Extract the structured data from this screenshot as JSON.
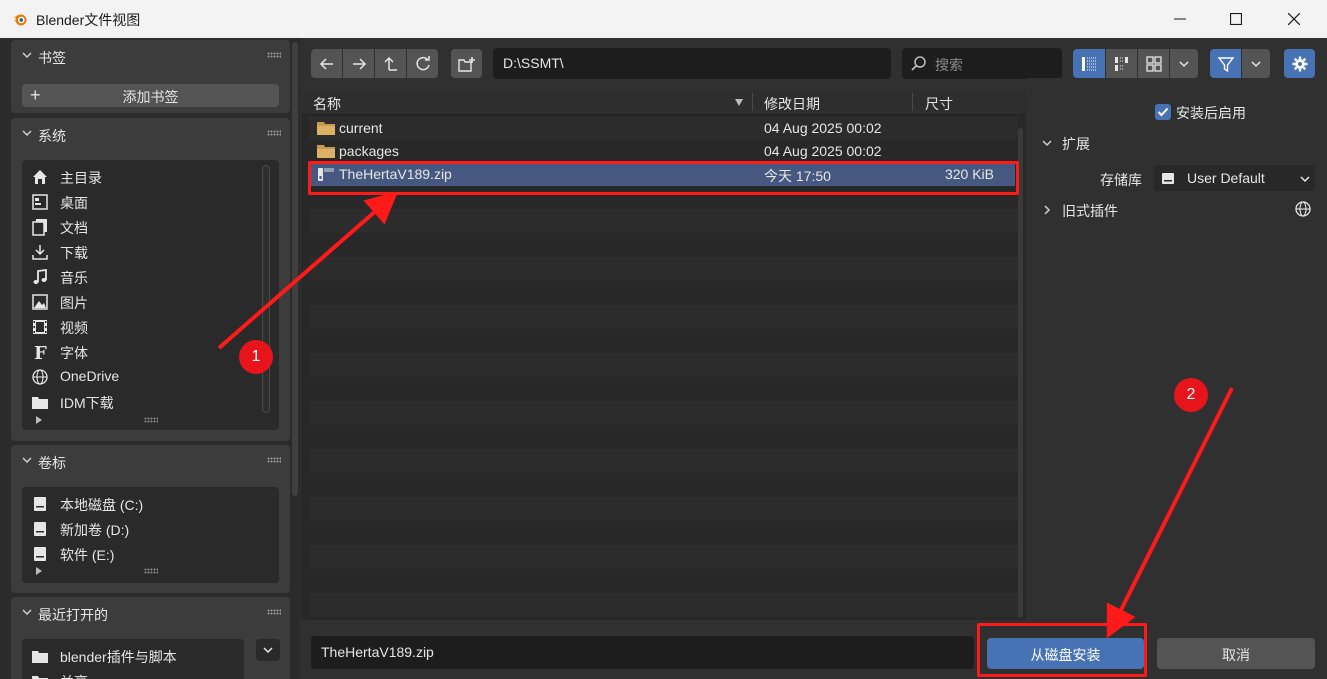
{
  "window": {
    "title": "Blender文件视图"
  },
  "toolbar": {
    "path": "D:\\SSMT\\",
    "search_placeholder": "搜索"
  },
  "sidebar": {
    "bookmarks": {
      "title": "书签",
      "add_label": "添加书签"
    },
    "system": {
      "title": "系统",
      "items": [
        {
          "label": "主目录",
          "icon": "home-icon"
        },
        {
          "label": "桌面",
          "icon": "desktop-icon"
        },
        {
          "label": "文档",
          "icon": "documents-icon"
        },
        {
          "label": "下载",
          "icon": "download-icon"
        },
        {
          "label": "音乐",
          "icon": "music-icon"
        },
        {
          "label": "图片",
          "icon": "image-icon"
        },
        {
          "label": "视频",
          "icon": "video-icon"
        },
        {
          "label": "字体",
          "icon": "font-icon"
        },
        {
          "label": "OneDrive",
          "icon": "globe-icon"
        },
        {
          "label": "IDM下载",
          "icon": "folder-icon"
        }
      ]
    },
    "volumes": {
      "title": "卷标",
      "items": [
        {
          "label": "本地磁盘 (C:)",
          "icon": "disk-icon"
        },
        {
          "label": "新加卷 (D:)",
          "icon": "disk-icon"
        },
        {
          "label": "软件 (E:)",
          "icon": "disk-icon"
        }
      ]
    },
    "recent": {
      "title": "最近打开的",
      "items": [
        {
          "label": "blender插件与脚本",
          "icon": "folder-icon"
        },
        {
          "label": "兰亭",
          "icon": "folder-icon"
        }
      ]
    }
  },
  "file_list": {
    "columns": {
      "name": "名称",
      "date": "修改日期",
      "size": "尺寸"
    },
    "rows": [
      {
        "name": "current",
        "date": "04 Aug 2025 00:02",
        "size": "",
        "type": "folder",
        "selected": false
      },
      {
        "name": "packages",
        "date": "04 Aug 2025 00:02",
        "size": "",
        "type": "folder",
        "selected": false
      },
      {
        "name": "TheHertaV189.zip",
        "date": "今天 17:50",
        "size": "320 KiB",
        "type": "zip",
        "selected": true
      }
    ]
  },
  "options": {
    "enable_on_install": {
      "label": "安装后启用",
      "checked": true
    },
    "extensions": {
      "title": "扩展",
      "repo_label": "存储库",
      "repo_value": "User Default"
    },
    "legacy": {
      "title": "旧式插件"
    }
  },
  "footer": {
    "filename": "TheHertaV189.zip",
    "install_label": "从磁盘安装",
    "cancel_label": "取消"
  },
  "annotations": {
    "badge1": "1",
    "badge2": "2"
  },
  "colors": {
    "accent": "#4772b3",
    "selection": "#46587f",
    "annotation_red": "#ff1a1a"
  }
}
